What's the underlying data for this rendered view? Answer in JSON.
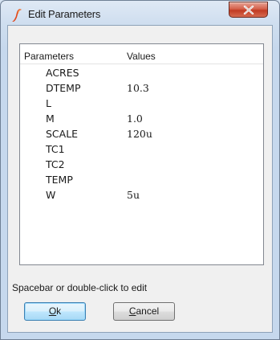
{
  "window": {
    "title": "Edit Parameters",
    "icon": "simetrix-logo-icon",
    "close_icon": "close-x-icon",
    "accent_close": "#c8452c"
  },
  "list": {
    "headers": {
      "parameters": "Parameters",
      "values": "Values"
    },
    "rows": [
      {
        "name": "ACRES",
        "value": ""
      },
      {
        "name": "DTEMP",
        "value": "10.3"
      },
      {
        "name": "L",
        "value": ""
      },
      {
        "name": "M",
        "value": "1.0"
      },
      {
        "name": "SCALE",
        "value": "120u"
      },
      {
        "name": "TC1",
        "value": ""
      },
      {
        "name": "TC2",
        "value": ""
      },
      {
        "name": "TEMP",
        "value": ""
      },
      {
        "name": "W",
        "value": "5u"
      }
    ]
  },
  "hint": "Spacebar or double-click to edit",
  "buttons": {
    "ok": {
      "accel": "O",
      "rest": "k"
    },
    "cancel": {
      "accel": "C",
      "rest": "ancel"
    }
  }
}
